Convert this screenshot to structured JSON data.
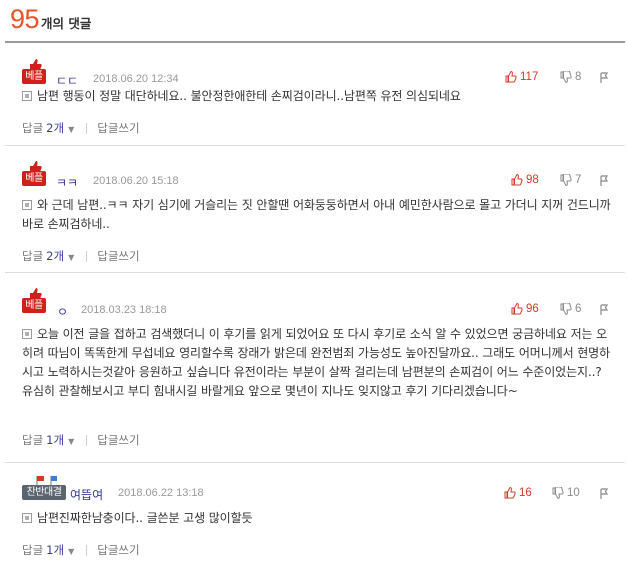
{
  "header": {
    "count": "95",
    "label": "개의 댓글"
  },
  "comments": [
    {
      "badge": "베플",
      "nickname": "ㄷㄷ",
      "date": "2018.06.20 12:34",
      "likes": "117",
      "dislikes": "8",
      "text": "남편 행동이 정말 대단하네요.. 불안정한애한테 손찌검이라니..남편쪽 유전 의심되네요",
      "reply_label": "답글",
      "reply_count": "2개",
      "write_label": "답글쓰기"
    },
    {
      "badge": "베플",
      "nickname": "ㅋㅋ",
      "date": "2018.06.20 15:18",
      "likes": "98",
      "dislikes": "7",
      "text": "와 근데 남편..ㅋㅋ 자기 심기에 거슬리는 짓 안할땐 어화둥둥하면서 아내 예민한사람으로 몰고 가더니 지꺼 건드니까 바로 손찌검하네..",
      "reply_label": "답글",
      "reply_count": "2개",
      "write_label": "답글쓰기"
    },
    {
      "badge": "베플",
      "nickname": "ㅇ",
      "date": "2018.03.23 18:18",
      "likes": "96",
      "dislikes": "6",
      "text": "오늘 이전 글을 접하고 검색했더니 이 후기를 읽게 되었어요 또 다시 후기로 소식 알 수 있었으면 궁금하네요 저는 오히려 따님이 똑똑한게 무섭네요 영리할수록 장래가 밝은데 완전범죄 가능성도 높아진달까요.. 그래도 어머니께서 현명하시고 노력하시는것같아 응원하고 싶습니다 유전이라는 부분이 살짝 걸리는데 남편분의 손찌검이 어느 수준이었는지..? 유심히 관찰해보시고 부디 힘내시길 바랄게요 앞으로 몇년이 지나도 잊지않고 후기 기다리겠습니다~",
      "reply_label": "답글",
      "reply_count": "1개",
      "write_label": "답글쓰기"
    },
    {
      "badge": "찬반대결",
      "nickname": "여뜹여",
      "date": "2018.06.22 13:18",
      "likes": "16",
      "dislikes": "10",
      "text": "남편진짜한남충이다.. 글쓴분 고생 많이할듯",
      "reply_label": "답글",
      "reply_count": "1개",
      "write_label": "답글쓰기"
    }
  ]
}
